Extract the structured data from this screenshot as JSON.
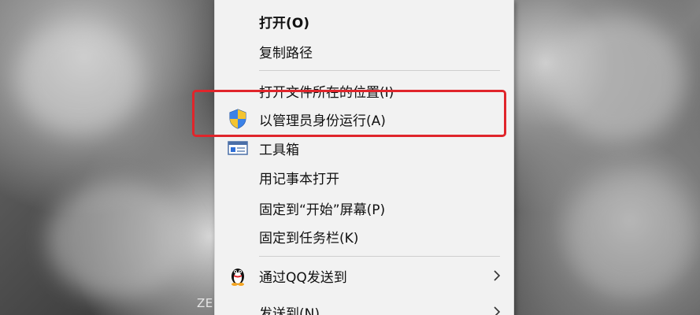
{
  "desktop": {
    "label": "ZE"
  },
  "menu": {
    "items": [
      {
        "label": "打开(O)",
        "icon": "",
        "submenu": false,
        "bold": true
      },
      {
        "label": "复制路径",
        "icon": "",
        "submenu": false,
        "bold": false
      },
      {
        "label": "打开文件所在的位置(I)",
        "icon": "",
        "submenu": false,
        "bold": false
      },
      {
        "label": "以管理员身份运行(A)",
        "icon": "uac-shield-icon",
        "submenu": false,
        "bold": false
      },
      {
        "label": "工具箱",
        "icon": "toolbox-icon",
        "submenu": false,
        "bold": false
      },
      {
        "label": "用记事本打开",
        "icon": "",
        "submenu": false,
        "bold": false
      },
      {
        "label": "固定到“开始”屏幕(P)",
        "icon": "",
        "submenu": false,
        "bold": false
      },
      {
        "label": "固定到任务栏(K)",
        "icon": "",
        "submenu": false,
        "bold": false
      },
      {
        "label": "通过QQ发送到",
        "icon": "qq-penguin-icon",
        "submenu": true,
        "bold": false
      },
      {
        "label": "发送到(N)",
        "icon": "",
        "submenu": true,
        "bold": false
      }
    ]
  },
  "annotation": {
    "highlight_color": "#e0252b",
    "highlighted_item": "以管理员身份运行(A)"
  },
  "colors": {
    "menu_background": "#f2f2f2",
    "separator": "#cfcfcf",
    "text": "#111111"
  }
}
